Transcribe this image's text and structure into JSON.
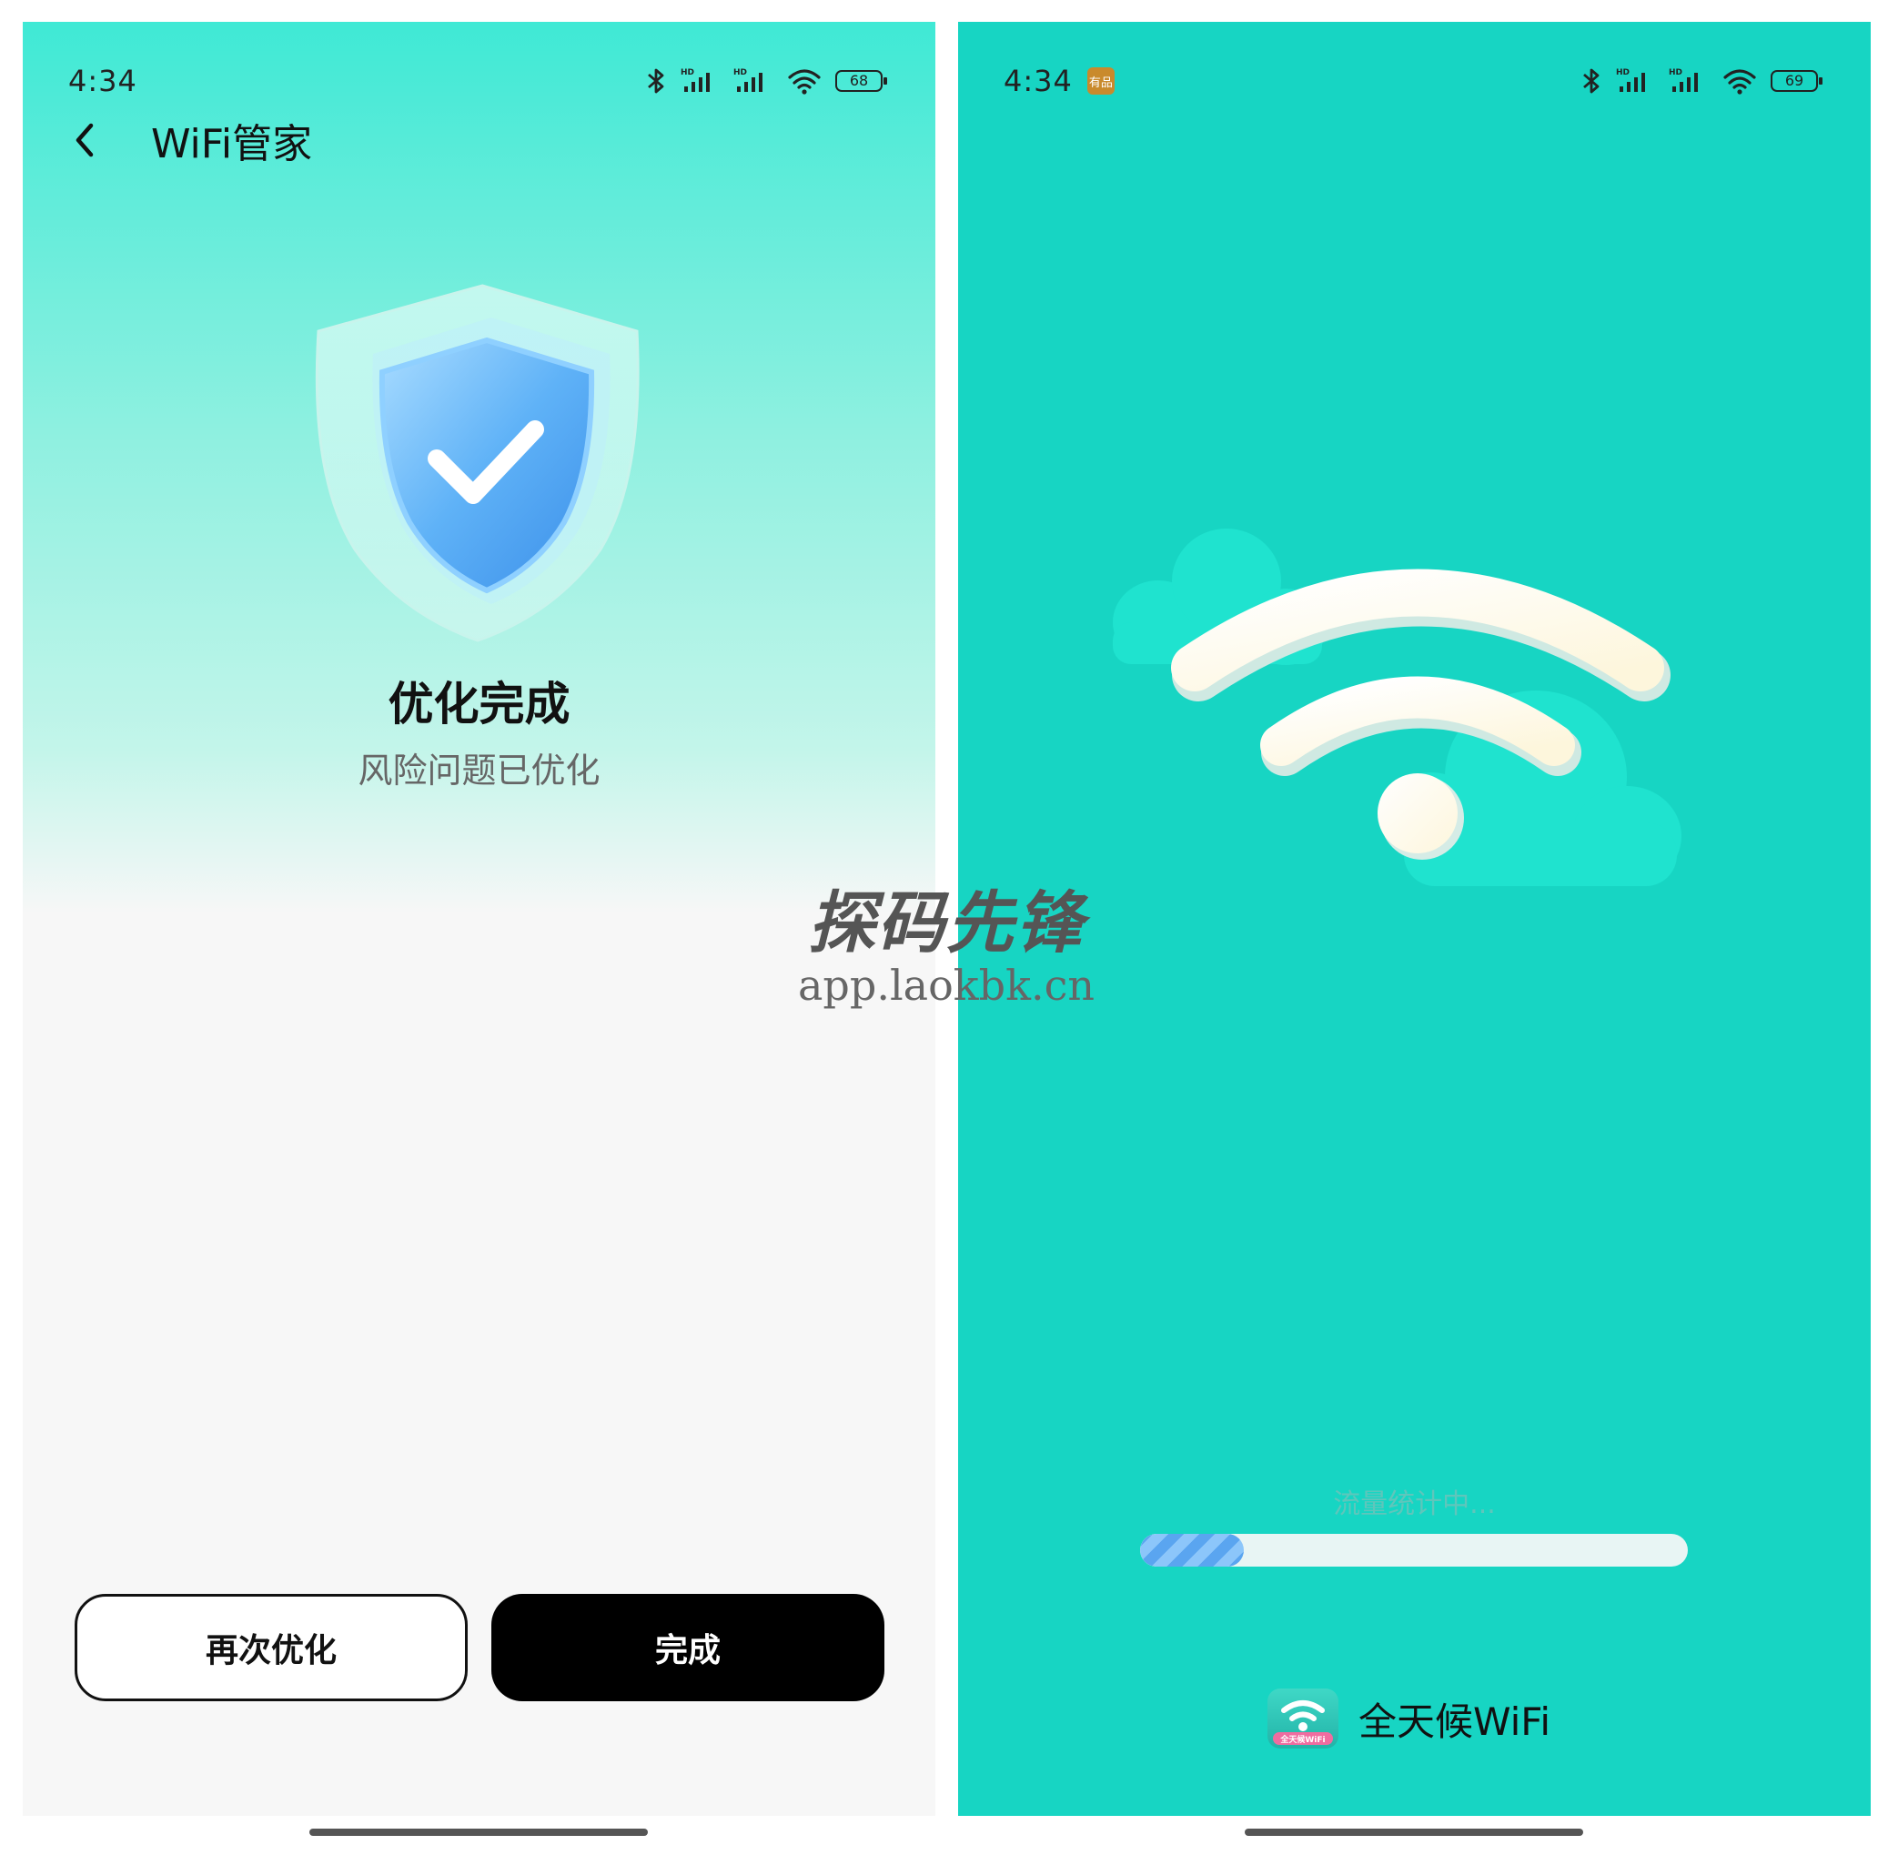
{
  "left_screen": {
    "status_time": "4:34",
    "battery": "68",
    "header_title": "WiFi管家",
    "result_title": "优化完成",
    "result_subtitle": "风险问题已优化",
    "btn_again": "再次优化",
    "btn_done": "完成"
  },
  "right_screen": {
    "status_time": "4:34",
    "status_badge": "有品",
    "battery": "69",
    "loading_text": "流量统计中...",
    "progress_fraction": 0.19,
    "brand_name": "全天候WiFi",
    "brand_logo_text": "全天候WiFi"
  },
  "watermark": {
    "cn": "探码先锋",
    "url": "app.laokbk.cn"
  },
  "colors": {
    "left_top": "#3fe9d5",
    "right_bg": "#17d5c3",
    "progress_fill": "#5aa5f0"
  }
}
